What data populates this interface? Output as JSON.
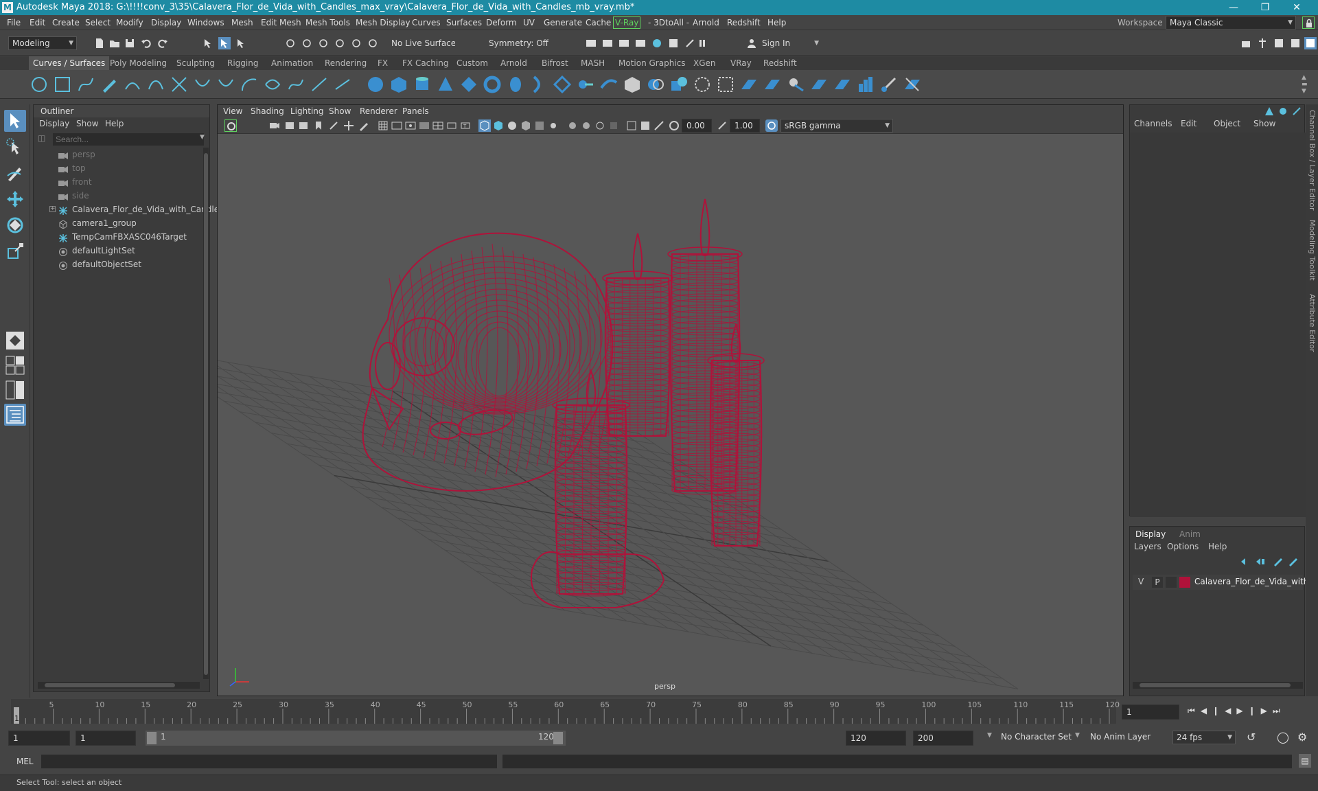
{
  "window": {
    "title": "Autodesk Maya 2018: G:\\!!!!conv_3\\35\\Calavera_Flor_de_Vida_with_Candles_max_vray\\Calavera_Flor_de_Vida_with_Candles_mb_vray.mb*",
    "logo_letter": "M"
  },
  "menubar": {
    "items": [
      "File",
      "Edit",
      "Create",
      "Select",
      "Modify",
      "Display",
      "Windows",
      "Mesh",
      "Edit Mesh",
      "Mesh Tools",
      "Mesh Display",
      "Curves",
      "Surfaces",
      "Deform",
      "UV",
      "Generate",
      "Cache",
      "V-Ray",
      "- 3DtoAll -",
      "Arnold",
      "Redshift",
      "Help"
    ],
    "workspace_label": "Workspace :",
    "workspace_value": "Maya Classic"
  },
  "statusline": {
    "mode": "Modeling",
    "live_surface": "No Live Surface",
    "symmetry": "Symmetry: Off",
    "sign_in": "Sign In"
  },
  "shelf": {
    "tabs": [
      "Curves / Surfaces",
      "Poly Modeling",
      "Sculpting",
      "Rigging",
      "Animation",
      "Rendering",
      "FX",
      "FX Caching",
      "Custom",
      "Arnold",
      "Bifrost",
      "MASH",
      "Motion Graphics",
      "XGen",
      "VRay",
      "Redshift"
    ],
    "active_tab": "Curves / Surfaces"
  },
  "outliner": {
    "title": "Outliner",
    "menu": [
      "Display",
      "Show",
      "Help"
    ],
    "search_placeholder": "Search...",
    "items": [
      {
        "label": "persp",
        "icon": "camera-icon",
        "dim": true
      },
      {
        "label": "top",
        "icon": "camera-icon",
        "dim": true
      },
      {
        "label": "front",
        "icon": "camera-icon",
        "dim": true
      },
      {
        "label": "side",
        "icon": "camera-icon",
        "dim": true
      },
      {
        "label": "Calavera_Flor_de_Vida_with_Candles_",
        "icon": "locator-icon",
        "dim": false,
        "expandable": true
      },
      {
        "label": "camera1_group",
        "icon": "group-icon",
        "dim": false
      },
      {
        "label": "TempCamFBXASC046Target",
        "icon": "locator-icon",
        "dim": false
      },
      {
        "label": "defaultLightSet",
        "icon": "set-icon",
        "dim": false
      },
      {
        "label": "defaultObjectSet",
        "icon": "set-icon",
        "dim": false
      }
    ]
  },
  "viewport": {
    "menu": [
      "View",
      "Shading",
      "Lighting",
      "Show",
      "Renderer",
      "Panels"
    ],
    "exposure": "0.00",
    "gamma": "1.00",
    "color_space": "sRGB gamma",
    "camera": "persp",
    "wire_color": "#b0123a"
  },
  "channelbox": {
    "tabs": [
      "Channels",
      "Edit",
      "Object",
      "Show"
    ]
  },
  "layereditor": {
    "tabs": [
      "Display",
      "Anim"
    ],
    "active_tab": "Display",
    "menu": [
      "Layers",
      "Options",
      "Help"
    ],
    "layer": {
      "v": "V",
      "p": "P",
      "name": "Calavera_Flor_de_Vida_with_C",
      "color": "#b0123a"
    }
  },
  "rightstrip": {
    "labels": [
      "Channel Box / Layer Editor",
      "Modeling Toolkit",
      "Attribute Editor"
    ]
  },
  "timeline": {
    "ticks": [
      "1",
      "5",
      "10",
      "15",
      "20",
      "25",
      "30",
      "35",
      "40",
      "45",
      "50",
      "55",
      "60",
      "65",
      "70",
      "75",
      "80",
      "85",
      "90",
      "95",
      "100",
      "105",
      "110",
      "115",
      "120"
    ],
    "current_frame": "1"
  },
  "range": {
    "start": "1",
    "playback_start": "1",
    "slider_start": "1",
    "slider_end": "120",
    "playback_end": "120",
    "end": "200",
    "character_set": "No Character Set",
    "anim_layer": "No Anim Layer",
    "fps": "24 fps"
  },
  "cmdline": {
    "label": "MEL"
  },
  "helpline": {
    "text": "Select Tool: select an object"
  }
}
